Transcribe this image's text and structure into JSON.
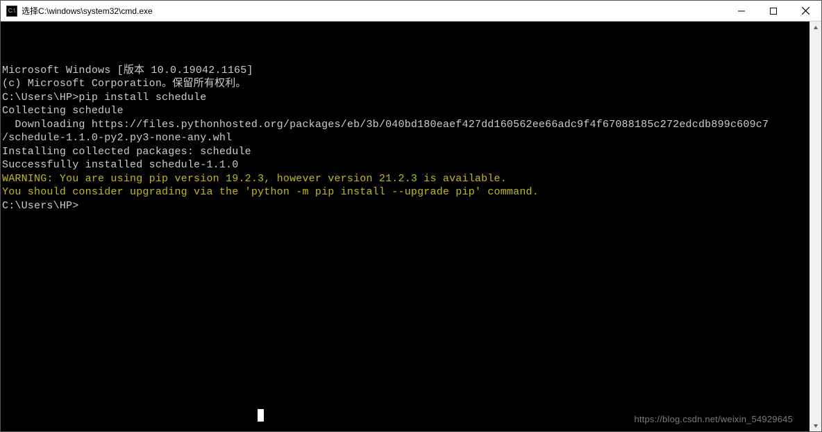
{
  "window": {
    "icon_label": "C:\\",
    "title": "选择C:\\windows\\system32\\cmd.exe"
  },
  "terminal": {
    "lines": [
      {
        "text": "Microsoft Windows [版本 10.0.19042.1165]",
        "class": ""
      },
      {
        "text": "(c) Microsoft Corporation。保留所有权利。",
        "class": ""
      },
      {
        "text": "",
        "class": ""
      },
      {
        "text": "C:\\Users\\HP>pip install schedule",
        "class": ""
      },
      {
        "text": "Collecting schedule",
        "class": ""
      },
      {
        "text": "  Downloading https://files.pythonhosted.org/packages/eb/3b/040bd180eaef427dd160562ee66adc9f4f67088185c272edcdb899c609c7",
        "class": ""
      },
      {
        "text": "/schedule-1.1.0-py2.py3-none-any.whl",
        "class": ""
      },
      {
        "text": "Installing collected packages: schedule",
        "class": ""
      },
      {
        "text": "Successfully installed schedule-1.1.0",
        "class": ""
      },
      {
        "text": "WARNING: You are using pip version 19.2.3, however version 21.2.3 is available.",
        "class": "yellow"
      },
      {
        "text": "You should consider upgrading via the 'python -m pip install --upgrade pip' command.",
        "class": "yellow"
      },
      {
        "text": "",
        "class": ""
      },
      {
        "text": "C:\\Users\\HP>",
        "class": ""
      }
    ]
  },
  "watermark": "https://blog.csdn.net/weixin_54929645"
}
